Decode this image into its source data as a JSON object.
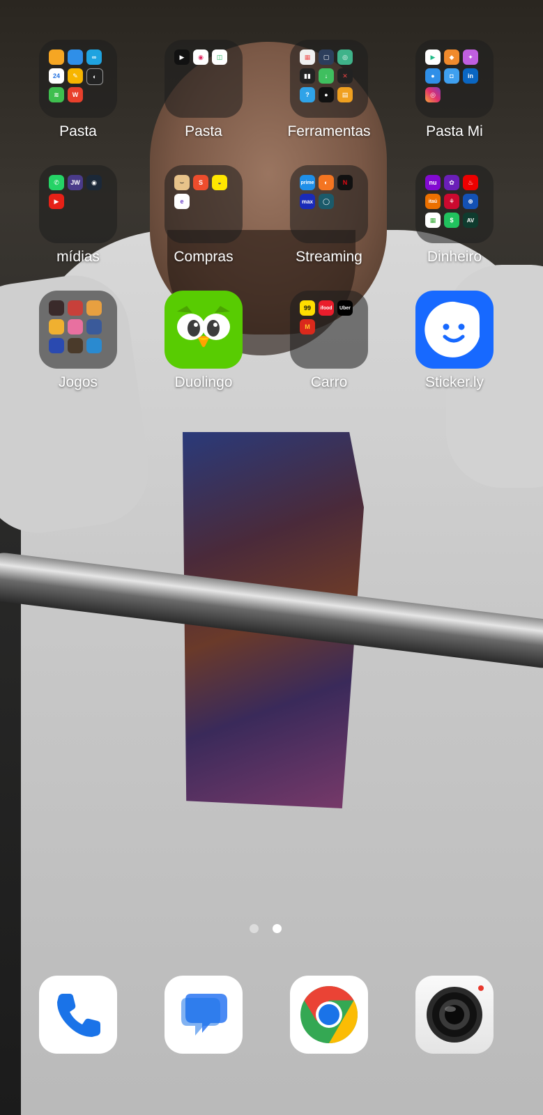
{
  "home": {
    "row1": [
      {
        "label": "Pasta",
        "type": "folder",
        "icons": [
          "files-icon",
          "weather-icon",
          "infinity-icon",
          "calendar-icon",
          "notes-icon",
          "compass-icon",
          "stack-icon",
          "wps-office-icon"
        ]
      },
      {
        "label": "Pasta",
        "type": "folder",
        "icons": [
          "play-icon",
          "music-icon",
          "cup-icon"
        ]
      },
      {
        "label": "Ferramentas",
        "type": "folder",
        "icons": [
          "calculator-icon",
          "scanner-icon",
          "signal-icon",
          "recorder-icon",
          "download-icon",
          "compass-icon",
          "help-icon",
          "camera-lens-icon",
          "book-icon"
        ]
      },
      {
        "label": "Pasta Mi",
        "type": "folder",
        "icons": [
          "play-store-icon",
          "mi-icon",
          "paint-icon",
          "browser-icon",
          "gamepad-icon",
          "linkedin-icon",
          "instagram-icon"
        ]
      }
    ],
    "row2": [
      {
        "label": "mídias",
        "type": "folder",
        "icons": [
          "whatsapp-icon",
          "jw-library-icon",
          "steam-icon",
          "youtube-icon"
        ]
      },
      {
        "label": "Compras",
        "type": "folder",
        "icons": [
          "amazon-icon",
          "shopee-icon",
          "mercado-livre-icon",
          "extra-icon"
        ]
      },
      {
        "label": "Streaming",
        "type": "folder",
        "icons": [
          "prime-video-icon",
          "crunchyroll-icon",
          "netflix-icon",
          "max-icon",
          "globoplay-icon"
        ]
      },
      {
        "label": "Dinheiro",
        "type": "folder",
        "icons": [
          "nubank-icon",
          "flower-icon",
          "santander-icon",
          "itau-icon",
          "bradesco-icon",
          "gov-icon",
          "grade-icon",
          "picpay-icon",
          "av-icon"
        ]
      }
    ],
    "row3": [
      {
        "label": "Jogos",
        "type": "folder",
        "icons": [
          "game1-icon",
          "game2-icon",
          "game3-icon",
          "game4-icon",
          "game5-icon",
          "game6-icon",
          "game7-icon",
          "game8-icon",
          "game9-icon"
        ]
      },
      {
        "label": "Duolingo",
        "type": "app"
      },
      {
        "label": "Carro",
        "type": "folder",
        "icons": [
          "99-icon",
          "ifood-icon",
          "uber-icon",
          "mcdonalds-icon"
        ]
      },
      {
        "label": "Sticker.ly",
        "type": "app"
      }
    ]
  },
  "mini_text": {
    "jw": "JW",
    "n99": "99",
    "ifood": "ifood",
    "uber": "Uber",
    "nu": "nu",
    "netflix": "N",
    "max": "max",
    "in": "in",
    "av": "AV",
    "mc": "M",
    "itau": "itaú",
    "prime": "prime",
    "w": "W",
    "cal": "24"
  },
  "page_indicator": {
    "pages": 2,
    "current": 2
  },
  "dock": [
    "phone-icon",
    "messages-icon",
    "chrome-icon",
    "camera-icon"
  ],
  "colors": {
    "duolingo_green": "#58cc02",
    "sticker_blue": "#1769ff",
    "phone_blue": "#1a73e8"
  }
}
